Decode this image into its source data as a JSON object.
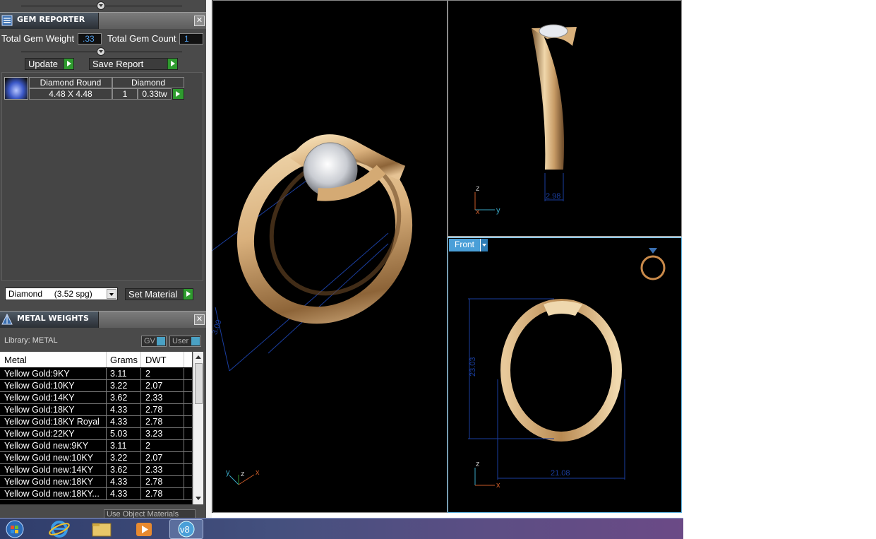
{
  "gem_reporter": {
    "title": "GEM REPORTER",
    "close": "✕",
    "total_weight_label": "Total Gem Weight",
    "total_weight_value": ".33",
    "total_count_label": "Total Gem Count",
    "total_count_value": "1",
    "update_label": "Update",
    "save_report_label": "Save Report",
    "gems": [
      {
        "shape": "Diamond Round",
        "size": "4.48 X 4.48",
        "material": "Diamond",
        "count": "1",
        "weight": "0.33tw"
      }
    ],
    "material_select": "Diamond     (3.52 spg)",
    "set_material_label": "Set Material"
  },
  "metal_weights": {
    "title": "METAL WEIGHTS",
    "close": "✕",
    "library_label": "Library: METAL",
    "gv_label": "GV",
    "user_label": "User",
    "columns": [
      "Metal",
      "Grams",
      "DWT"
    ],
    "rows": [
      {
        "metal": "Yellow Gold:9KY",
        "grams": "3.11",
        "dwt": "2"
      },
      {
        "metal": "Yellow Gold:10KY",
        "grams": "3.22",
        "dwt": "2.07"
      },
      {
        "metal": "Yellow Gold:14KY",
        "grams": "3.62",
        "dwt": "2.33"
      },
      {
        "metal": "Yellow Gold:18KY",
        "grams": "4.33",
        "dwt": "2.78"
      },
      {
        "metal": "Yellow Gold:18KY Royal",
        "grams": "4.33",
        "dwt": "2.78"
      },
      {
        "metal": "Yellow Gold:22KY",
        "grams": "5.03",
        "dwt": "3.23"
      },
      {
        "metal": "Yellow Gold new:9KY",
        "grams": "3.11",
        "dwt": "2"
      },
      {
        "metal": "Yellow Gold new:10KY",
        "grams": "3.22",
        "dwt": "2.07"
      },
      {
        "metal": "Yellow Gold new:14KY",
        "grams": "3.62",
        "dwt": "2.33"
      },
      {
        "metal": "Yellow Gold new:18KY",
        "grams": "4.33",
        "dwt": "2.78"
      },
      {
        "metal": "Yellow Gold new:18KY...",
        "grams": "4.33",
        "dwt": "2.78"
      }
    ],
    "use_object_materials": "Use Object Materials"
  },
  "viewports": {
    "perspective": {
      "axes": {
        "x": "x",
        "y": "y",
        "z": "z"
      },
      "dimension": "3.00"
    },
    "side": {
      "dimension": "2.98",
      "axes": {
        "v": "z",
        "h": "y",
        "corner": "x"
      }
    },
    "front": {
      "tab_label": "Front",
      "height_dim": "23.03",
      "width_dim": "21.08",
      "axes": {
        "v": "z",
        "h": "x"
      }
    }
  },
  "taskbar": {
    "items": [
      "start-orb-icon",
      "internet-explorer-icon",
      "file-explorer-icon",
      "media-player-icon",
      "matrix-v8-icon"
    ]
  },
  "colors": {
    "gold_light": "#f0d7ab",
    "gold_dark": "#7a5630",
    "dimension_blue": "#1a3ea0",
    "accent_green": "#2f9b2f",
    "accent_blue": "#4a9fd8"
  }
}
